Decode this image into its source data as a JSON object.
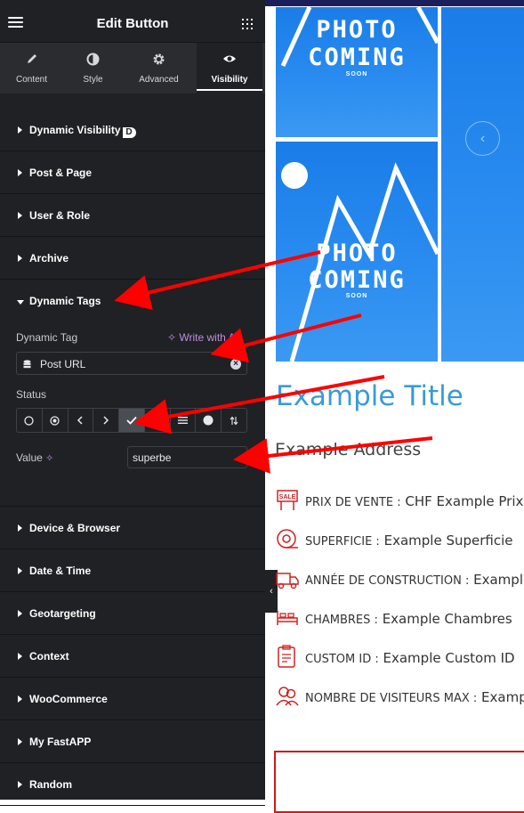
{
  "header": {
    "title": "Edit Button",
    "menu_icon": "hamburger-icon",
    "apps_icon": "grid-icon"
  },
  "tabs": [
    {
      "label": "Content",
      "icon": "pencil-icon"
    },
    {
      "label": "Style",
      "icon": "half-circle-icon"
    },
    {
      "label": "Advanced",
      "icon": "gear-icon"
    },
    {
      "label": "Visibility",
      "icon": "eye-icon",
      "active": true
    }
  ],
  "sections_top": [
    "Dynamic Visibility",
    "Post & Page",
    "User & Role",
    "Archive"
  ],
  "dynamic_tags": {
    "title": "Dynamic Tags",
    "dynamic_tag_label": "Dynamic Tag",
    "ai_link": "Write with AI",
    "tag_value": "Post URL",
    "status_label": "Status",
    "status_buttons": [
      "circle-icon",
      "dot-circle-icon",
      "chevron-left-icon",
      "chevron-right-icon",
      "check-icon",
      "equals-icon",
      "lines-icon",
      "filled-circle-icon",
      "sort-icon"
    ],
    "status_selected": "check-icon",
    "value_label": "Value",
    "value": "superbe"
  },
  "sections_bottom": [
    "Device & Browser",
    "Date & Time",
    "Geotargeting",
    "Context",
    "WooCommerce",
    "My FastAPP",
    "Random"
  ],
  "preview": {
    "photo_line1": "PHOTO",
    "photo_line2": "COMING",
    "photo_soon": "SOON",
    "title": "Example Title",
    "address": "Example Address",
    "properties": [
      {
        "icon": "sale-sign-icon",
        "key": "PRIX DE VENTE :",
        "value": "CHF Example Prix"
      },
      {
        "icon": "tape-measure-icon",
        "key": "SUPERFICIE :",
        "value": "Example Superficie"
      },
      {
        "icon": "truck-building-icon",
        "key": "ANNÉE DE CONSTRUCTION :",
        "value": "Example"
      },
      {
        "icon": "bed-icon",
        "key": "CHAMBRES :",
        "value": "Example Chambres"
      },
      {
        "icon": "clipboard-icon",
        "key": "CUSTOM ID :",
        "value": "Example Custom ID"
      },
      {
        "icon": "people-icon",
        "key": "NOMBRE DE VISITEURS MAX :",
        "value": "Example"
      }
    ]
  },
  "colors": {
    "panel": "#1f2124",
    "accent_ai": "#c08ee0",
    "title_blue": "#3a9bd6",
    "icon_red": "#d42020",
    "arrow_red": "#ff0000"
  }
}
